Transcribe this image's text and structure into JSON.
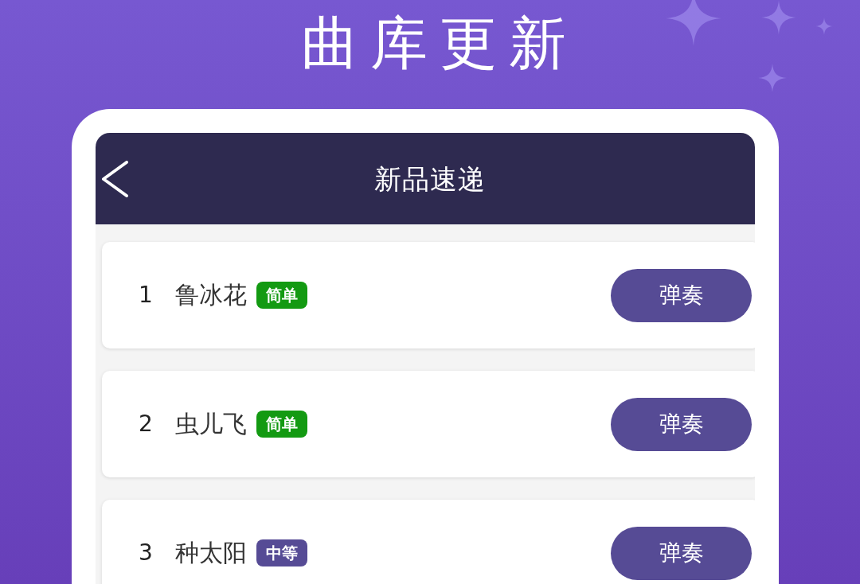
{
  "banner": {
    "title": "曲库更新"
  },
  "screen": {
    "header": {
      "title": "新品速递"
    },
    "songs": [
      {
        "number": "1",
        "title": "鲁冰花",
        "difficulty": {
          "label": "简单",
          "color": "#139a12"
        },
        "button": "弹奏"
      },
      {
        "number": "2",
        "title": "虫儿飞",
        "difficulty": {
          "label": "简单",
          "color": "#139a12"
        },
        "button": "弹奏"
      },
      {
        "number": "3",
        "title": "种太阳",
        "difficulty": {
          "label": "中等",
          "color": "#564b95"
        },
        "button": "弹奏"
      }
    ]
  }
}
